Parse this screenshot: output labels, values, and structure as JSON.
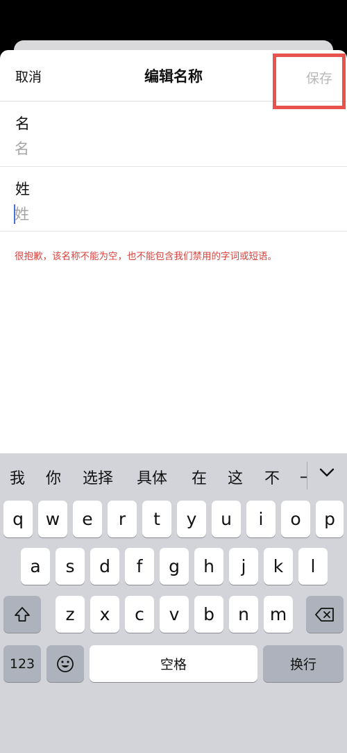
{
  "nav": {
    "cancel_label": "取消",
    "title": "编辑名称",
    "save_label": "保存"
  },
  "form": {
    "first_name": {
      "label": "名",
      "placeholder": "名",
      "value": ""
    },
    "last_name": {
      "label": "姓",
      "placeholder": "姓",
      "value": ""
    },
    "error": "很抱歉，该名称不能为空，也不能包含我们禁用的字词或短语。"
  },
  "keyboard": {
    "candidates": [
      "我",
      "你",
      "选择",
      "具体",
      "在",
      "这",
      "不",
      "一"
    ],
    "row1": [
      "q",
      "w",
      "e",
      "r",
      "t",
      "y",
      "u",
      "i",
      "o",
      "p"
    ],
    "row2": [
      "a",
      "s",
      "d",
      "f",
      "g",
      "h",
      "j",
      "k",
      "l"
    ],
    "row3": [
      "z",
      "x",
      "c",
      "v",
      "b",
      "n",
      "m"
    ],
    "numbers_label": "123",
    "space_label": "空格",
    "return_label": "换行",
    "icons": {
      "shift": "shift-icon",
      "delete": "backspace-icon",
      "emoji": "emoji-icon",
      "expand": "chevron-down-icon"
    }
  },
  "colors": {
    "error": "#d9433d",
    "highlight": "#e8534e",
    "save_disabled": "#b8b8bb"
  }
}
